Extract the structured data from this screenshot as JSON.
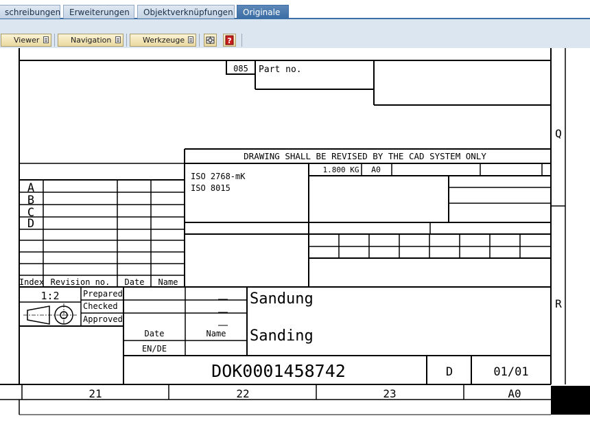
{
  "tabs": [
    {
      "label": "schreibungen"
    },
    {
      "label": "Erweiterungen"
    },
    {
      "label": "Objektverknüpfungen"
    },
    {
      "label": "Originale",
      "active": true
    }
  ],
  "toolbar": {
    "viewer_label": "Viewer",
    "navigation_label": "Navigation",
    "werkzeuge_label": "Werkzeuge",
    "icons": [
      "settings-icon",
      "help-icon"
    ]
  },
  "drawing": {
    "part_code": "085",
    "part_no_label": "Part no.",
    "revision_notice": "DRAWING SHALL BE REVISED BY THE CAD SYSTEM ONLY",
    "weight": "1.800 KG",
    "format_top": "A0",
    "standard_1": "ISO 2768-mK",
    "standard_2": "ISO 8015",
    "revision_letters": [
      "A",
      "B",
      "C",
      "D"
    ],
    "revision_headers": {
      "index": "Index",
      "revision_no": "Revision no.",
      "date": "Date",
      "name": "Name"
    },
    "scale": "1:2",
    "prepared": "Prepared",
    "checked": "Checked",
    "approved": "Approved",
    "date_label": "Date",
    "name_label": "Name",
    "language": "EN/DE",
    "title_1": "Sandung",
    "title_2": "Sanding",
    "document_number": "DOK0001458742",
    "version": "D",
    "sheet": "01/01",
    "zone_row_q": "Q",
    "zone_row_r": "R",
    "zone_columns": [
      "21",
      "22",
      "23"
    ],
    "format_bottom": "A0"
  },
  "colors": {
    "tab_active": "#3a6ea5",
    "toolbar_bg": "#dbe6f1",
    "button_bg": "#f3e7b8"
  }
}
